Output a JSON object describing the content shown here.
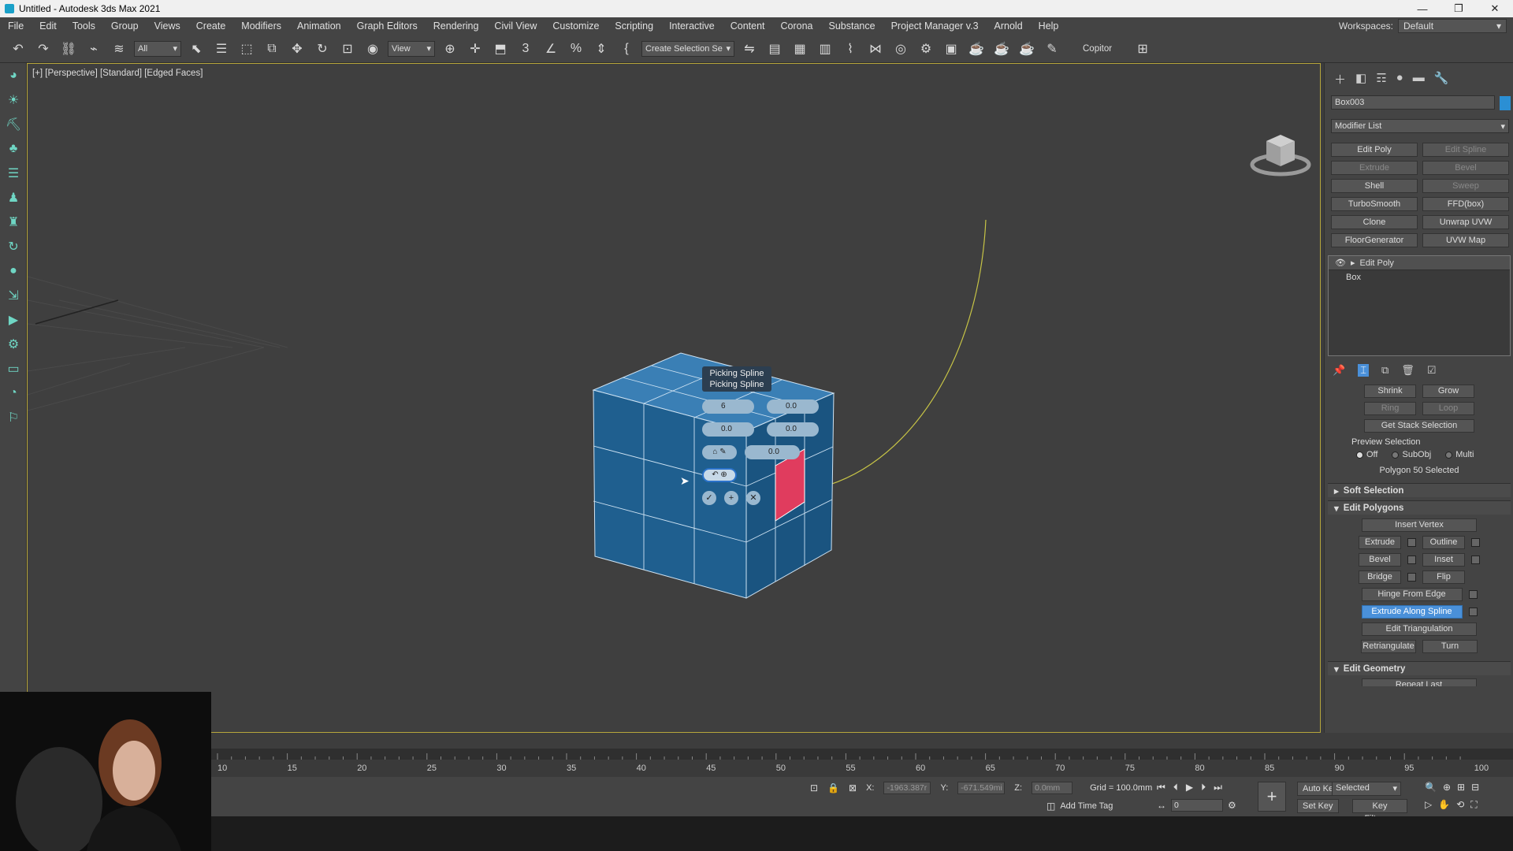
{
  "window": {
    "title": "Untitled - Autodesk 3ds Max 2021",
    "controls": [
      "—",
      "❐",
      "✕"
    ]
  },
  "menu": {
    "items": [
      "File",
      "Edit",
      "Tools",
      "Group",
      "Views",
      "Create",
      "Modifiers",
      "Animation",
      "Graph Editors",
      "Rendering",
      "Civil View",
      "Customize",
      "Scripting",
      "Interactive",
      "Content",
      "Corona",
      "Substance",
      "Project Manager v.3",
      "Arnold",
      "Help"
    ],
    "workspaces_label": "Workspaces:",
    "workspaces_value": "Default"
  },
  "toolbar": {
    "filter_value": "All",
    "ref_coord_value": "View",
    "selection_set_value": "Create Selection Se",
    "copitor_label": "Copitor"
  },
  "viewport": {
    "label": "[+] [Perspective] [Standard] [Edged Faces]"
  },
  "caddy": {
    "title_line1": "Picking Spline",
    "title_line2": "Picking Spline",
    "segments": "6",
    "taper_amount": "0.0",
    "taper_curve": "0.0",
    "twist": "0.0",
    "rotation": "0.0"
  },
  "command_panel": {
    "object_name": "Box003",
    "object_color": "#2b8fd4",
    "modifier_list": "Modifier List",
    "modifier_buttons": [
      {
        "label": "Edit Poly",
        "dim": false
      },
      {
        "label": "Edit Spline",
        "dim": true
      },
      {
        "label": "Extrude",
        "dim": true
      },
      {
        "label": "Bevel",
        "dim": true
      },
      {
        "label": "Shell",
        "dim": false
      },
      {
        "label": "Sweep",
        "dim": true
      },
      {
        "label": "TurboSmooth",
        "dim": false
      },
      {
        "label": "FFD(box)",
        "dim": false
      },
      {
        "label": "Clone",
        "dim": false
      },
      {
        "label": "Unwrap UVW",
        "dim": false
      },
      {
        "label": "FloorGenerator",
        "dim": false
      },
      {
        "label": "UVW Map",
        "dim": false
      }
    ],
    "stack": {
      "modifier": "Edit Poly",
      "base": "Box"
    },
    "selection": {
      "shrink": "Shrink",
      "grow": "Grow",
      "ring": "Ring",
      "loop": "Loop",
      "get_stack": "Get Stack Selection",
      "preview_label": "Preview Selection",
      "preview_off": "Off",
      "preview_subobj": "SubObj",
      "preview_multi": "Multi",
      "status": "Polygon 50 Selected"
    },
    "soft_selection": "Soft Selection",
    "edit_polygons": {
      "title": "Edit Polygons",
      "insert_vertex": "Insert Vertex",
      "extrude": "Extrude",
      "outline": "Outline",
      "bevel": "Bevel",
      "inset": "Inset",
      "bridge": "Bridge",
      "flip": "Flip",
      "hinge": "Hinge From Edge",
      "extrude_spline": "Extrude Along Spline",
      "edit_triangulation": "Edit Triangulation",
      "retriangulate": "Retriangulate",
      "turn": "Turn"
    },
    "edit_geometry": "Edit Geometry",
    "repeat_last": "Repeat Last"
  },
  "timeline": {
    "ticks": [
      "10",
      "15",
      "20",
      "25",
      "30",
      "35",
      "40",
      "45",
      "50",
      "55",
      "60",
      "65",
      "70",
      "75",
      "80",
      "85",
      "90",
      "95",
      "100"
    ]
  },
  "status": {
    "x_label": "X:",
    "x_value": "-1963.387r",
    "y_label": "Y:",
    "y_value": "-671.549mi",
    "z_label": "Z:",
    "z_value": "0.0mm",
    "grid": "Grid = 100.0mm",
    "add_time_tag": "Add Time Tag",
    "auto_key": "Auto Key",
    "selected": "Selected",
    "set_key": "Set Key",
    "key_filters": "Key Filters...",
    "frame": "0"
  }
}
